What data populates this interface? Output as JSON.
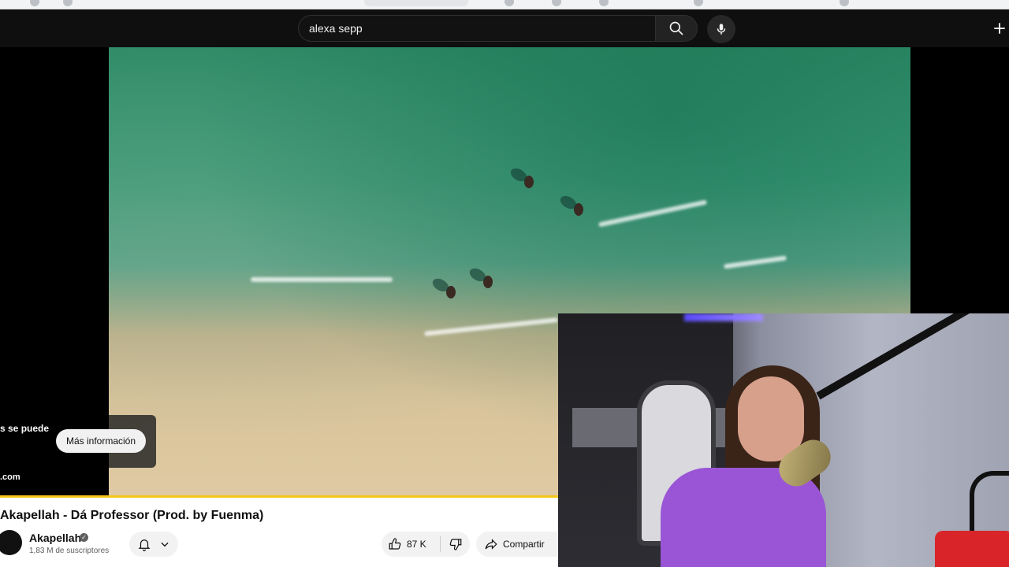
{
  "search": {
    "query": "alexa sepp"
  },
  "ad": {
    "text_fragment": "s se puede",
    "domain_fragment": ".com",
    "more_info_label": "Más información"
  },
  "video": {
    "title": "Akapellah - Dá Professor (Prod. by Fuenma)"
  },
  "channel": {
    "name": "Akapellah",
    "subscribers": "1,83 M de suscriptores"
  },
  "actions": {
    "like_count": "87 K",
    "share_label": "Compartir"
  },
  "icons": {
    "search": "search-icon",
    "mic": "mic-icon",
    "create": "plus-icon",
    "bell": "bell-icon",
    "chevron": "chevron-down-icon",
    "like": "thumbs-up-icon",
    "dislike": "thumbs-down-icon",
    "share": "share-icon",
    "verified": "verified-icon"
  },
  "colors": {
    "progress": "#f5c518",
    "background": "#0f0f0f"
  }
}
